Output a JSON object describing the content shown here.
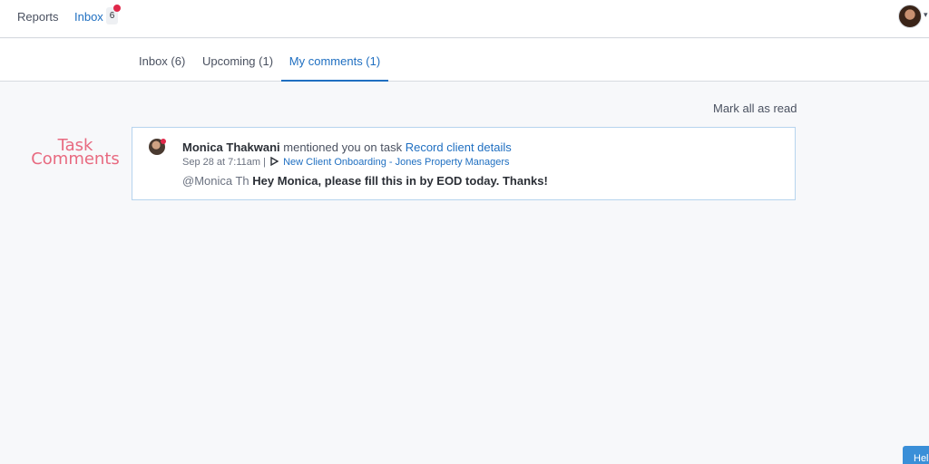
{
  "topnav": {
    "reports_label": "Reports",
    "inbox_label": "Inbox",
    "inbox_count": "6"
  },
  "tabs": [
    {
      "label": "Inbox (6)"
    },
    {
      "label": "Upcoming (1)"
    },
    {
      "label": "My comments (1)",
      "active": true
    }
  ],
  "actions": {
    "mark_all_read": "Mark all as read"
  },
  "annotation": {
    "line1": "Task",
    "line2": "Comments"
  },
  "notification": {
    "author": "Monica Thakwani",
    "action_text": "mentioned you on task",
    "task_name": "Record client details",
    "timestamp": "Sep 28 at 7:11am",
    "separator": "|",
    "project_name": "New Client Onboarding - Jones Property Managers",
    "mention": "@Monica Th",
    "message": "Hey Monica, please fill this in by EOD today. Thanks!"
  },
  "help": {
    "label": "Help"
  },
  "colors": {
    "accent": "#1f6fc1",
    "badge_dot": "#e0284a",
    "annotation": "#e86a80"
  }
}
